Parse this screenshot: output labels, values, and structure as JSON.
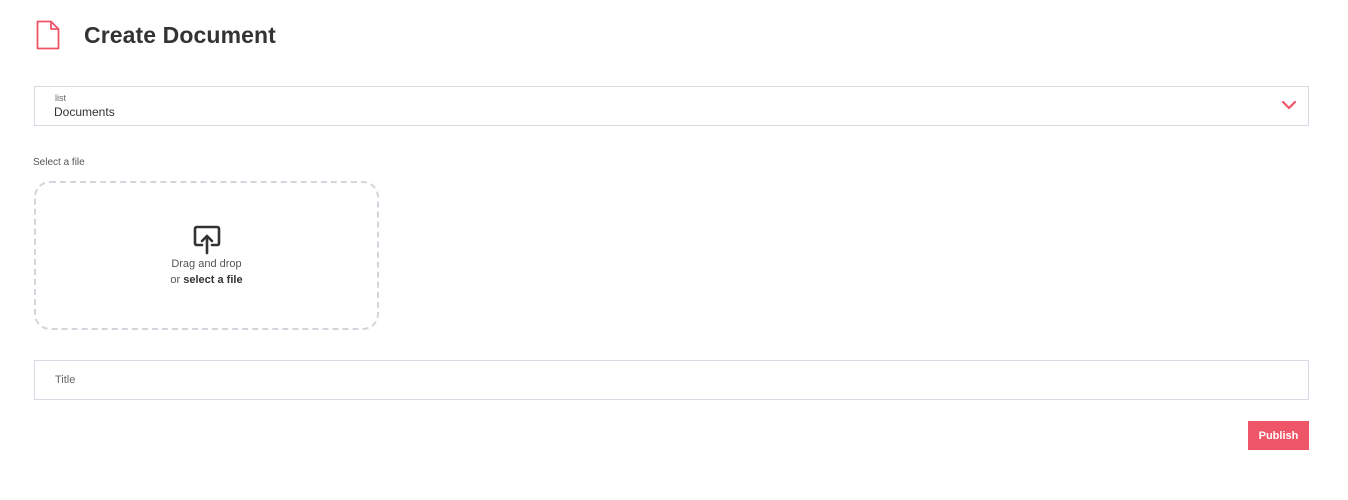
{
  "header": {
    "icon": "document-icon",
    "title": "Create Document"
  },
  "list_select": {
    "label": "list",
    "value": "Documents",
    "icon": "chevron-down-icon"
  },
  "file_upload": {
    "label": "Select a file",
    "icon": "upload-icon",
    "drag_text": "Drag and drop",
    "or_text": "or ",
    "select_link": "select a file"
  },
  "title_field": {
    "placeholder": "Title",
    "value": ""
  },
  "actions": {
    "publish_label": "Publish"
  },
  "colors": {
    "accent": "#ee5667",
    "border": "#d6dbe4",
    "dropzone_border": "#d3d5dc",
    "text": "#333333"
  }
}
